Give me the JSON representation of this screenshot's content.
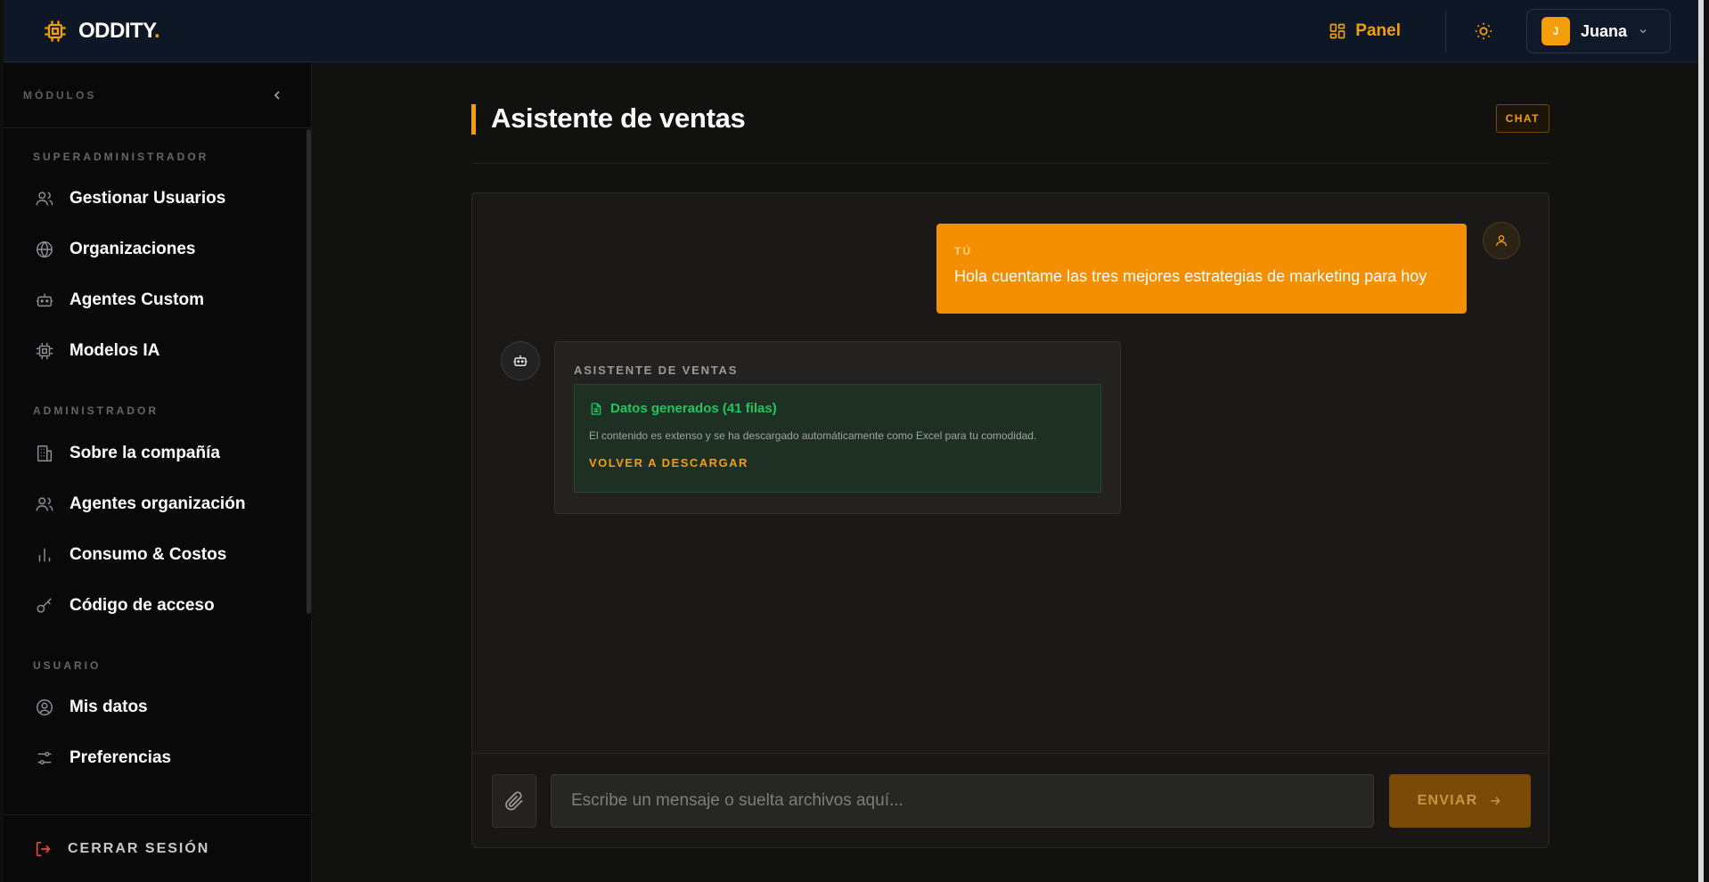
{
  "brand": {
    "name": "ODDITY",
    "dot": "."
  },
  "topbar": {
    "panel_label": "Panel",
    "user_initial": "J",
    "user_name": "Juana"
  },
  "sidebar": {
    "header": "MÓDULOS",
    "sections": [
      {
        "title": "SUPERADMINISTRADOR",
        "items": [
          {
            "label": "Gestionar Usuarios",
            "icon": "users-icon"
          },
          {
            "label": "Organizaciones",
            "icon": "globe-icon"
          },
          {
            "label": "Agentes Custom",
            "icon": "robot-icon"
          },
          {
            "label": "Modelos IA",
            "icon": "chip-icon"
          }
        ]
      },
      {
        "title": "ADMINISTRADOR",
        "items": [
          {
            "label": "Sobre la compañía",
            "icon": "building-icon"
          },
          {
            "label": "Agentes organización",
            "icon": "users-icon"
          },
          {
            "label": "Consumo & Costos",
            "icon": "bar-chart-icon"
          },
          {
            "label": "Código de acceso",
            "icon": "key-icon"
          }
        ]
      },
      {
        "title": "USUARIO",
        "items": [
          {
            "label": "Mis datos",
            "icon": "user-circle-icon"
          },
          {
            "label": "Preferencias",
            "icon": "sliders-icon"
          }
        ]
      }
    ],
    "logout_label": "CERRAR SESIÓN"
  },
  "main": {
    "title": "Asistente de ventas",
    "badge": "CHAT",
    "messages": {
      "user": {
        "who": "TÚ",
        "text": "Hola cuentame las tres mejores estrategias de marketing para hoy"
      },
      "bot": {
        "who": "ASISTENTE DE VENTAS",
        "card_title": "Datos generados (41 filas)",
        "card_desc": "El contenido es extenso y se ha descargado automáticamente como Excel para tu comodidad.",
        "card_link": "VOLVER A DESCARGAR"
      }
    },
    "composer": {
      "placeholder": "Escribe un mensaje o suelta archivos aquí...",
      "send_label": "ENVIAR"
    }
  },
  "colors": {
    "accent": "#f59e0b",
    "success": "#22c55e",
    "topbar": "#0e1726"
  }
}
